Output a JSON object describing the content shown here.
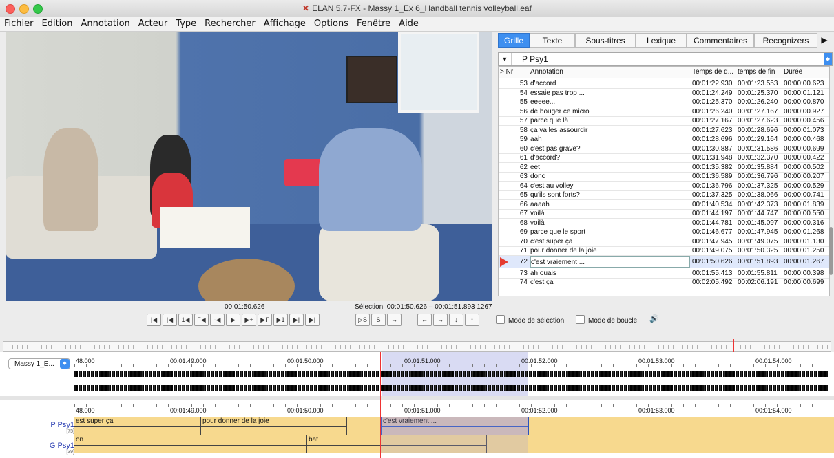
{
  "window": {
    "title": "ELAN 5.7-FX - Massy 1_Ex 6_Handball tennis volleyball.eaf",
    "logo": "ELAN-logo-icon"
  },
  "menu": [
    "Fichier",
    "Edition",
    "Annotation",
    "Acteur",
    "Type",
    "Rechercher",
    "Affichage",
    "Options",
    "Fenêtre",
    "Aide"
  ],
  "player": {
    "time": "00:01:50.626",
    "selection": "Sélection: 00:01:50.626 – 00:01:51.893  1267",
    "transport": [
      "|◀",
      "|◀",
      "1◀",
      "F◀",
      "-◀",
      "▶",
      "▶+",
      "▶F",
      "▶1",
      "▶|",
      "▶|"
    ],
    "sel_buttons": [
      "▷S",
      "S",
      "→"
    ],
    "nav_buttons": [
      "←",
      "→",
      "↓",
      "↑"
    ],
    "mode_selection": "Mode de sélection",
    "mode_loop": "Mode de boucle"
  },
  "tabs": [
    "Grille",
    "Texte",
    "Sous-titres",
    "Lexique",
    "Commentaires",
    "Recognizers"
  ],
  "active_tab": "Grille",
  "tier_selector": "P Psy1",
  "grid": {
    "headers": {
      "nr": "> Nr",
      "annotation": "Annotation",
      "start": "Temps de d...",
      "end": "temps de fin",
      "duration": "Durée"
    },
    "rows": [
      {
        "nr": "53",
        "text": "d'accord",
        "start": "00:01:22.930",
        "end": "00:01:23.553",
        "dur": "00:00:00.623"
      },
      {
        "nr": "54",
        "text": "essaie pas trop ...",
        "start": "00:01:24.249",
        "end": "00:01:25.370",
        "dur": "00:00:01.121"
      },
      {
        "nr": "55",
        "text": "eeeee...",
        "start": "00:01:25.370",
        "end": "00:01:26.240",
        "dur": "00:00:00.870"
      },
      {
        "nr": "56",
        "text": "de bouger ce micro",
        "start": "00:01:26.240",
        "end": "00:01:27.167",
        "dur": "00:00:00.927"
      },
      {
        "nr": "57",
        "text": "parce que là",
        "start": "00:01:27.167",
        "end": "00:01:27.623",
        "dur": "00:00:00.456"
      },
      {
        "nr": "58",
        "text": "ça va les assourdir",
        "start": "00:01:27.623",
        "end": "00:01:28.696",
        "dur": "00:00:01.073"
      },
      {
        "nr": "59",
        "text": "aah",
        "start": "00:01:28.696",
        "end": "00:01:29.164",
        "dur": "00:00:00.468"
      },
      {
        "nr": "60",
        "text": "c'est pas grave?",
        "start": "00:01:30.887",
        "end": "00:01:31.586",
        "dur": "00:00:00.699"
      },
      {
        "nr": "61",
        "text": "d'accord?",
        "start": "00:01:31.948",
        "end": "00:01:32.370",
        "dur": "00:00:00.422"
      },
      {
        "nr": "62",
        "text": "eet",
        "start": "00:01:35.382",
        "end": "00:01:35.884",
        "dur": "00:00:00.502"
      },
      {
        "nr": "63",
        "text": "donc",
        "start": "00:01:36.589",
        "end": "00:01:36.796",
        "dur": "00:00:00.207"
      },
      {
        "nr": "64",
        "text": "c'est au volley",
        "start": "00:01:36.796",
        "end": "00:01:37.325",
        "dur": "00:00:00.529"
      },
      {
        "nr": "65",
        "text": "qu'ils sont forts?",
        "start": "00:01:37.325",
        "end": "00:01:38.066",
        "dur": "00:00:00.741"
      },
      {
        "nr": "66",
        "text": "aaaah",
        "start": "00:01:40.534",
        "end": "00:01:42.373",
        "dur": "00:00:01.839"
      },
      {
        "nr": "67",
        "text": "voilà",
        "start": "00:01:44.197",
        "end": "00:01:44.747",
        "dur": "00:00:00.550"
      },
      {
        "nr": "68",
        "text": "voilà",
        "start": "00:01:44.781",
        "end": "00:01:45.097",
        "dur": "00:00:00.316"
      },
      {
        "nr": "69",
        "text": "parce que le sport",
        "start": "00:01:46.677",
        "end": "00:01:47.945",
        "dur": "00:00:01.268"
      },
      {
        "nr": "70",
        "text": "c'est super ça",
        "start": "00:01:47.945",
        "end": "00:01:49.075",
        "dur": "00:00:01.130"
      },
      {
        "nr": "71",
        "text": "pour donner de la joie",
        "start": "00:01:49.075",
        "end": "00:01:50.325",
        "dur": "00:00:01.250"
      },
      {
        "nr": "72",
        "text": "c'est vraiement ...",
        "start": "00:01:50.626",
        "end": "00:01:51.893",
        "dur": "00:00:01.267"
      },
      {
        "nr": "73",
        "text": "ah ouais",
        "start": "00:01:55.413",
        "end": "00:01:55.811",
        "dur": "00:00:00.398"
      },
      {
        "nr": "74",
        "text": "c'est ça",
        "start": "00:02:05.492",
        "end": "00:02:06.191",
        "dur": "00:00:00.699"
      }
    ],
    "current_nr": "72"
  },
  "media_select": "Massy 1_E...",
  "ruler_labels": [
    "48.000",
    "00:01:49.000",
    "00:01:50.000",
    "00:01:51.000",
    "00:01:52.000",
    "00:01:53.000",
    "00:01:54.000"
  ],
  "tiers": [
    {
      "name": "P Psy1",
      "count": "[75]",
      "annotations": [
        "est super ça",
        "pour donner de la joie",
        "c'est vraiement ..."
      ]
    },
    {
      "name": "G Psy1",
      "count": "[39]",
      "annotations": [
        "on",
        "bat",
        ""
      ]
    }
  ],
  "colors": {
    "accent": "#3e8ff0",
    "tier_band": "#f7d98e",
    "selection": "#d9dbf3",
    "cursor": "#e33333"
  }
}
